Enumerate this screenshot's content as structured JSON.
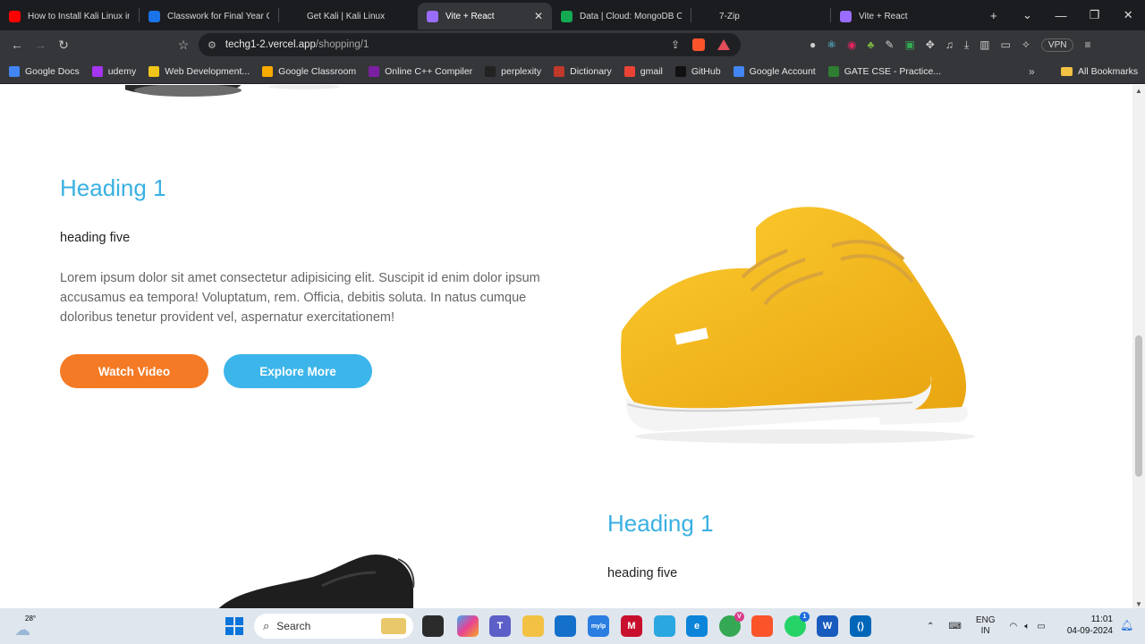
{
  "tabs": [
    {
      "title": "How to Install Kali Linux in",
      "icon": "youtube-icon",
      "color": "#ff0000",
      "active": false
    },
    {
      "title": "Classwork for Final Year C",
      "icon": "classroom-icon",
      "color": "#1a73e8",
      "active": false
    },
    {
      "title": "Get Kali | Kali Linux",
      "icon": "kali-dragon-icon",
      "color": "#1b1c1f",
      "active": false
    },
    {
      "title": "Vite + React",
      "icon": "vite-icon",
      "color": "#9a6cff",
      "active": true
    },
    {
      "title": "Data | Cloud: MongoDB C",
      "icon": "mongodb-leaf-icon",
      "color": "#13aa52",
      "active": false
    },
    {
      "title": "7-Zip",
      "icon": "7zip-icon",
      "color": "#1b1c1f",
      "active": false
    },
    {
      "title": "Vite + React",
      "icon": "vite-icon",
      "color": "#9a6cff",
      "active": false
    }
  ],
  "address": {
    "host": "techg1-2.vercel.app",
    "path": "/shopping/1"
  },
  "bookmarks": [
    {
      "label": "Google Docs",
      "color": "#4285f4"
    },
    {
      "label": "udemy",
      "color": "#a435f0"
    },
    {
      "label": "Web Development...",
      "color": "#f0c419"
    },
    {
      "label": "Google Classroom",
      "color": "#f9ab00"
    },
    {
      "label": "Online C++ Compiler",
      "color": "#7b1fa2"
    },
    {
      "label": "perplexity",
      "color": "#222222"
    },
    {
      "label": "Dictionary",
      "color": "#c0392b"
    },
    {
      "label": "gmail",
      "color": "#ea4335"
    },
    {
      "label": "GitHub",
      "color": "#111111"
    },
    {
      "label": "Google Account",
      "color": "#4285f4"
    },
    {
      "label": "GATE CSE - Practice...",
      "color": "#2e7d32"
    }
  ],
  "all_bookmarks": "All Bookmarks",
  "vpn": "VPN",
  "section1": {
    "title": "Heading 1",
    "subtitle": "heading five",
    "body": "Lorem ipsum dolor sit amet consectetur adipisicing elit. Suscipit id enim dolor ipsum accusamus ea tempora! Voluptatum, rem. Officia, debitis soluta. In natus cumque doloribus tenetur provident vel, aspernatur exercitationem!",
    "watch_label": "Watch Video",
    "explore_label": "Explore More"
  },
  "section2": {
    "title": "Heading 1",
    "subtitle": "heading five"
  },
  "colors": {
    "accent_blue": "#3ab0e2",
    "button_orange": "#f47a25",
    "button_blue": "#3cb5ea",
    "shoe_yellow": "#f5b81c"
  },
  "taskbar": {
    "weather": "28°",
    "search_placeholder": "Search",
    "lang_top": "ENG",
    "lang_bottom": "IN",
    "time": "11:01",
    "date": "04-09-2024"
  }
}
